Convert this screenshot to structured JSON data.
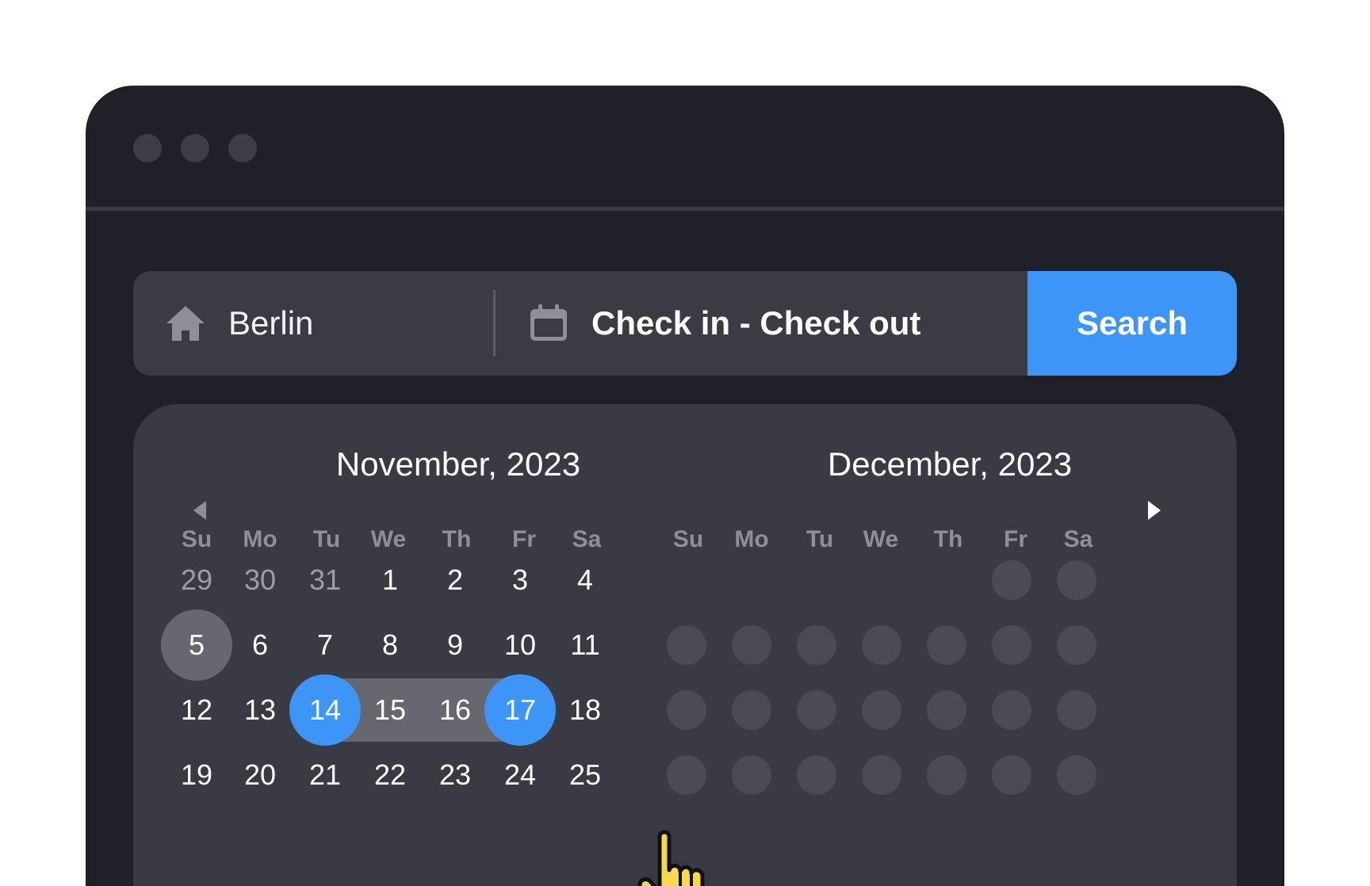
{
  "search": {
    "location": "Berlin",
    "dates_label": "Check in - Check out",
    "button_label": "Search"
  },
  "calendar": {
    "left_month": "November, 2023",
    "right_month": "December, 2023",
    "weekdays": [
      "Su",
      "Mo",
      "Tu",
      "We",
      "Th",
      "Fr",
      "Sa"
    ],
    "rows": [
      [
        "29",
        "30",
        "31",
        "1",
        "2",
        "3",
        "4"
      ],
      [
        "5",
        "6",
        "7",
        "8",
        "9",
        "10",
        "11"
      ],
      [
        "12",
        "13",
        "14",
        "15",
        "16",
        "17",
        "18"
      ],
      [
        "19",
        "20",
        "21",
        "22",
        "23",
        "24",
        "25"
      ]
    ],
    "muted_days": [
      "29",
      "30",
      "31"
    ],
    "today": "5",
    "range_start": "14",
    "range_end": "17",
    "range_between": [
      "15",
      "16"
    ]
  },
  "icons": {
    "home": "home-icon",
    "calendar": "calendar-icon",
    "prev": "triangle-left-icon",
    "next": "triangle-right-icon",
    "cursor": "hand-pointer-icon"
  },
  "colors": {
    "accent": "#3d95f8",
    "window_bg": "#202128",
    "panel_bg": "#393a43",
    "range_bg": "#67686f",
    "cursor_fill": "#f7d94c"
  }
}
